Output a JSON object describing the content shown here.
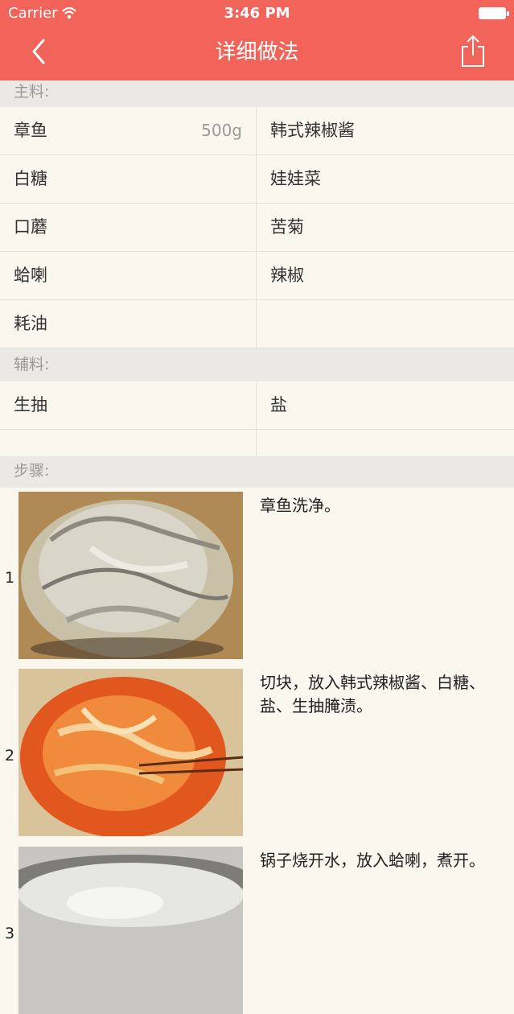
{
  "status_bar": {
    "carrier": "Carrier",
    "time": "3:46 PM"
  },
  "nav": {
    "title": "详细做法"
  },
  "sections": {
    "main": "主料:",
    "aux": "辅料:",
    "steps": "步骤:"
  },
  "main_ingredients": [
    [
      {
        "name": "章鱼",
        "amount": "500g"
      },
      {
        "name": "韩式辣椒酱",
        "amount": ""
      }
    ],
    [
      {
        "name": "白糖",
        "amount": ""
      },
      {
        "name": "娃娃菜",
        "amount": ""
      }
    ],
    [
      {
        "name": "口蘑",
        "amount": ""
      },
      {
        "name": "苦菊",
        "amount": ""
      }
    ],
    [
      {
        "name": "蛤喇",
        "amount": ""
      },
      {
        "name": "辣椒",
        "amount": ""
      }
    ],
    [
      {
        "name": "耗油",
        "amount": ""
      },
      {
        "name": "",
        "amount": ""
      }
    ]
  ],
  "aux_ingredients": [
    [
      {
        "name": "生抽",
        "amount": ""
      },
      {
        "name": "盐",
        "amount": ""
      }
    ],
    [
      {
        "name": "",
        "amount": ""
      },
      {
        "name": "",
        "amount": ""
      }
    ]
  ],
  "steps": [
    {
      "number": "1",
      "text": "章鱼洗净。"
    },
    {
      "number": "2",
      "text": "切块，放入韩式辣椒酱、白糖、盐、生抽腌渍。"
    },
    {
      "number": "3",
      "text": "锅子烧开水，放入蛤喇，煮开。"
    }
  ]
}
